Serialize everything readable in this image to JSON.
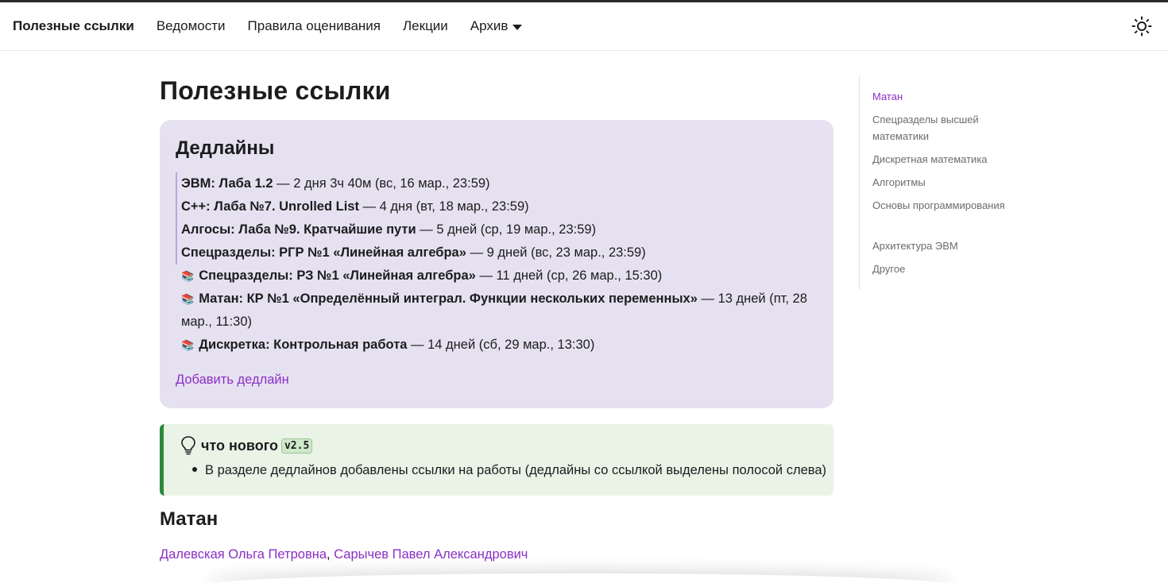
{
  "nav": {
    "brand": "Полезные ссылки",
    "links": [
      "Ведомости",
      "Правила оценивания",
      "Лекции"
    ],
    "archive": "Архив",
    "theme_icon": "sun-icon"
  },
  "page": {
    "title": "Полезные ссылки"
  },
  "deadlines": {
    "title": "Дедлайны",
    "items": [
      {
        "subject": "ЭВМ: Лаба 1.2",
        "rest": " — 2 дня 3ч 40м (вс, 16 мар., 23:59)",
        "linked": true
      },
      {
        "subject": "C++: Лаба №7. Unrolled List",
        "rest": " — 4 дня (вт, 18 мар., 23:59)",
        "linked": true
      },
      {
        "subject": "Алгосы: Лаба №9. Кратчайшие пути",
        "rest": " — 5 дней (ср, 19 мар., 23:59)",
        "linked": true
      },
      {
        "subject": "Спецразделы: РГР №1 «Линейная алгебра»",
        "rest": " — 9 дней (вс, 23 мар., 23:59)",
        "linked": true
      },
      {
        "icon": "📚",
        "subject": "Спецразделы: РЗ №1 «Линейная алгебра»",
        "rest": " — 11 дней (ср, 26 мар., 15:30)",
        "linked": false
      },
      {
        "icon": "📚",
        "subject": "Матан: КР №1 «Определённый интеграл. Функции нескольких переменных»",
        "rest": " — 13 дней (пт, 28 мар., 11:30)",
        "linked": false
      },
      {
        "icon": "📚",
        "subject": "Дискретка: Контрольная работа",
        "rest": " — 14 дней (сб, 29 мар., 13:30)",
        "linked": false
      }
    ],
    "add_link": "Добавить дедлайн"
  },
  "news": {
    "title": "что нового",
    "version": "v2.5",
    "items": [
      "В разделе дедлайнов добавлены ссылки на работы (дедлайны со ссылкой выделены полосой слева)"
    ]
  },
  "section": {
    "title": "Матан",
    "teacher1": "Далевская Ольга Петровна",
    "separator": ", ",
    "teacher2": "Сарычев Павел Александрович"
  },
  "toc": {
    "items": [
      "Матан",
      "Спецразделы высшей математики",
      "Дискретная математика",
      "Алгоритмы",
      "Основы программирования",
      "Архитектура ЭВМ",
      "Другое"
    ]
  },
  "colors": {
    "accent": "#8a2fc6",
    "card_bg": "#e6e1f0",
    "news_bg": "#e9f3e6",
    "news_border": "#2a8a3a"
  }
}
